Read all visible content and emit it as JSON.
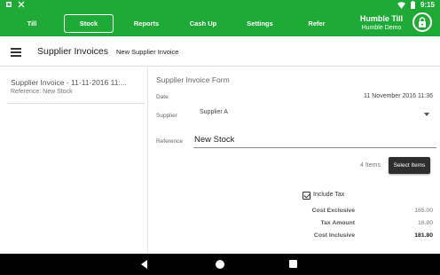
{
  "status_bar": {
    "time": "9:15",
    "left_icons": [
      "notification-icon",
      "app-notification-icon"
    ],
    "right_icons": [
      "wifi-icon",
      "battery-icon"
    ]
  },
  "nav": {
    "tabs": [
      {
        "label": "Till",
        "active": false
      },
      {
        "label": "Stock",
        "active": true
      },
      {
        "label": "Reports",
        "active": false
      },
      {
        "label": "Cash Up",
        "active": false
      },
      {
        "label": "Settings",
        "active": false
      },
      {
        "label": "Refer",
        "active": false
      }
    ],
    "brand_title": "Humble Till",
    "brand_subtitle": "Humble Demo",
    "lock_icon": "lock-icon"
  },
  "toolbar": {
    "menu_icon": "hamburger-menu-icon",
    "title": "Supplier Invoices",
    "subtitle": "New Supplier Invoice"
  },
  "invoice_list": [
    {
      "title": "Supplier Invoice - 11-11-2016 11:...",
      "reference": "Reference: New Stock"
    }
  ],
  "form": {
    "title": "Supplier Invoice Form",
    "date_label": "Date",
    "date_value": "11 November 2016 11:36",
    "supplier_label": "Supplier",
    "supplier_value": "Supplier A",
    "reference_label": "Reference",
    "reference_value": "New Stock",
    "items_count": "4 Items",
    "select_items_label": "Select Items",
    "include_tax_label": "Include Tax",
    "include_tax_checked": true,
    "totals": [
      {
        "label": "Cost Exclusive",
        "value": "165.00"
      },
      {
        "label": "Tax Amount",
        "value": "16.80"
      },
      {
        "label": "Cost Inclusive",
        "value": "181.80"
      }
    ]
  },
  "colors": {
    "primary": "#1faa38",
    "button_dark": "#2e2e2e"
  }
}
